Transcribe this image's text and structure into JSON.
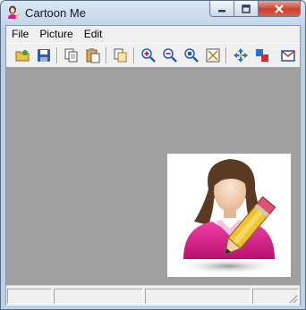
{
  "window": {
    "title": "Cartoon Me",
    "app_icon": "user-pencil-icon",
    "caption_buttons": [
      "minimize-icon",
      "maximize-icon",
      "close-icon"
    ]
  },
  "menu": {
    "items": [
      {
        "label": "File"
      },
      {
        "label": "Picture"
      },
      {
        "label": "Edit"
      }
    ]
  },
  "toolbar": {
    "buttons": [
      {
        "icon": "open-icon",
        "tooltip": ""
      },
      {
        "icon": "save-icon",
        "tooltip": ""
      },
      {
        "icon": "copy-icon",
        "tooltip": ""
      },
      {
        "icon": "paste-icon",
        "tooltip": ""
      },
      {
        "icon": "paste-new-icon",
        "tooltip": ""
      },
      {
        "icon": "zoom-in-icon",
        "tooltip": ""
      },
      {
        "icon": "zoom-out-icon",
        "tooltip": ""
      },
      {
        "icon": "actual-size-icon",
        "tooltip": ""
      },
      {
        "icon": "fit-window-icon",
        "tooltip": ""
      },
      {
        "icon": "move-icon",
        "tooltip": ""
      },
      {
        "icon": "resize-icon",
        "tooltip": ""
      },
      {
        "icon": "email-icon",
        "tooltip": ""
      }
    ]
  },
  "canvas": {
    "background": "#a0a0a0",
    "image": "cartoon-avatar-with-pencil"
  },
  "colors": {
    "shirt": "#d61f8f",
    "hair": "#5a3a22",
    "skin": "#f3d2b8",
    "pencil": "#f2c230",
    "close_button": "#c8412f"
  },
  "statusbar": {
    "panes": [
      "",
      "",
      "",
      ""
    ]
  }
}
